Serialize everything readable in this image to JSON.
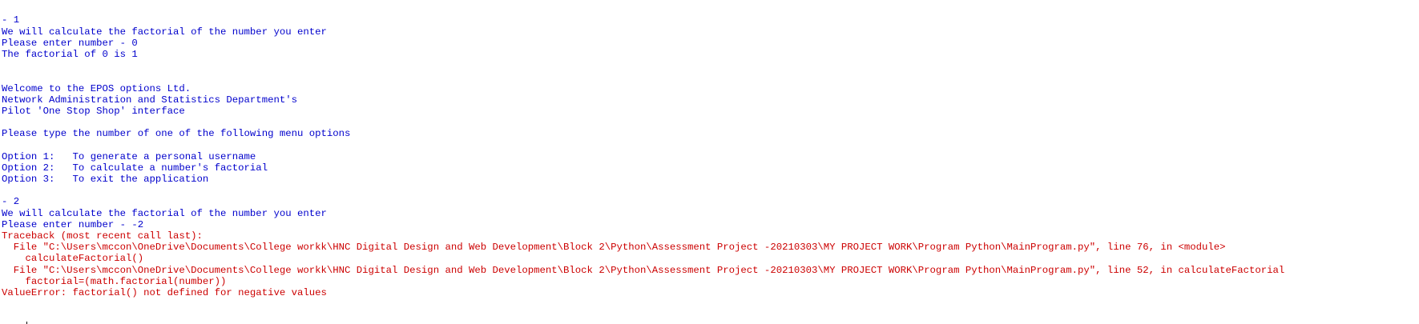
{
  "shell": {
    "lines": [
      {
        "kind": "out",
        "text": "- 1"
      },
      {
        "kind": "out",
        "text": "We will calculate the factorial of the number you enter"
      },
      {
        "kind": "out",
        "text": "Please enter number - 0"
      },
      {
        "kind": "out",
        "text": "The factorial of 0 is 1"
      },
      {
        "kind": "out",
        "text": ""
      },
      {
        "kind": "out",
        "text": ""
      },
      {
        "kind": "out",
        "text": "Welcome to the EPOS options Ltd."
      },
      {
        "kind": "out",
        "text": "Network Administration and Statistics Department's"
      },
      {
        "kind": "out",
        "text": "Pilot 'One Stop Shop' interface"
      },
      {
        "kind": "out",
        "text": ""
      },
      {
        "kind": "out",
        "text": "Please type the number of one of the following menu options"
      },
      {
        "kind": "out",
        "text": ""
      },
      {
        "kind": "out",
        "text": "Option 1:   To generate a personal username"
      },
      {
        "kind": "out",
        "text": "Option 2:   To calculate a number's factorial"
      },
      {
        "kind": "out",
        "text": "Option 3:   To exit the application"
      },
      {
        "kind": "out",
        "text": ""
      },
      {
        "kind": "out",
        "text": "- 2"
      },
      {
        "kind": "out",
        "text": "We will calculate the factorial of the number you enter"
      },
      {
        "kind": "out",
        "text": "Please enter number - -2"
      },
      {
        "kind": "err",
        "text": "Traceback (most recent call last):"
      },
      {
        "kind": "err",
        "text": "  File \"C:\\Users\\mccon\\OneDrive\\Documents\\College workk\\HNC Digital Design and Web Development\\Block 2\\Python\\Assessment Project -20210303\\MY PROJECT WORK\\Program Python\\MainProgram.py\", line 76, in <module>"
      },
      {
        "kind": "err",
        "text": "    calculateFactorial()"
      },
      {
        "kind": "err",
        "text": "  File \"C:\\Users\\mccon\\OneDrive\\Documents\\College workk\\HNC Digital Design and Web Development\\Block 2\\Python\\Assessment Project -20210303\\MY PROJECT WORK\\Program Python\\MainProgram.py\", line 52, in calculateFactorial"
      },
      {
        "kind": "err",
        "text": "    factorial=(math.factorial(number))"
      },
      {
        "kind": "err",
        "text": "ValueError: factorial() not defined for negative values"
      }
    ],
    "prompt": ">>> "
  }
}
